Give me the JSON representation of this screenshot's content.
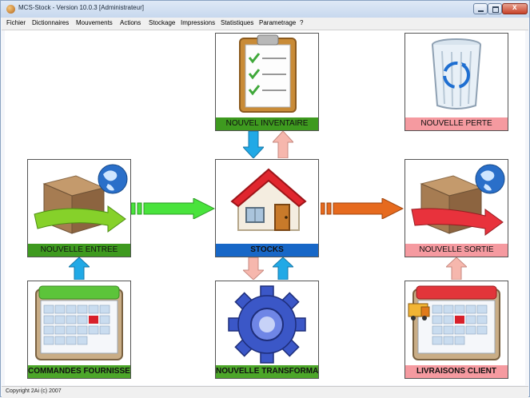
{
  "window": {
    "title": "MCS-Stock - Version 10.0.3 [Administrateur]"
  },
  "menu": {
    "items": [
      "Fichier",
      "Dictionnaires",
      "Mouvements",
      "Actions",
      "Stockage",
      "Impressions",
      "Statistiques",
      "Parametrage",
      "?"
    ]
  },
  "tiles": {
    "inventaire": {
      "label": "NOUVEL INVENTAIRE",
      "icon": "clipboard-checklist-icon"
    },
    "perte": {
      "label": "NOUVELLE PERTE",
      "icon": "recycle-bin-icon"
    },
    "entree": {
      "label": "NOUVELLE ENTREE",
      "icon": "incoming-box-icon"
    },
    "stocks": {
      "label": "STOCKS",
      "icon": "house-icon"
    },
    "sortie": {
      "label": "NOUVELLE SORTIE",
      "icon": "outgoing-box-icon"
    },
    "commandes": {
      "label": "COMMANDES FOURNISSEUR",
      "icon": "calendar-icon"
    },
    "transformation": {
      "label": "NOUVELLE TRANSFORMATION",
      "icon": "gear-icon"
    },
    "livraisons": {
      "label": "LIVRAISONS CLIENT",
      "icon": "delivery-calendar-icon"
    }
  },
  "colors": {
    "green_label": "#3e9a1f",
    "red_label": "#f59aa0",
    "blue_label": "#1767c7",
    "arrow_blue": "#21a9e6",
    "arrow_pink": "#f6b7ad",
    "arrow_green": "#49e33c",
    "arrow_orange": "#e66a1e"
  },
  "status": {
    "text": "Copyright 2Ai (c) 2007"
  }
}
